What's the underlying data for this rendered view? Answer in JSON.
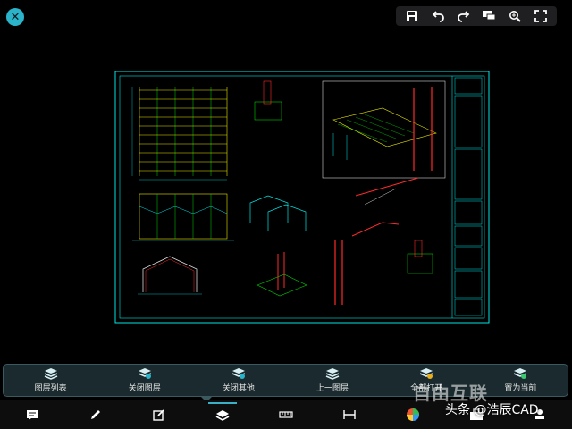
{
  "top_toolbar": {
    "icons": [
      "save-icon",
      "undo-icon",
      "redo-icon",
      "comment-icon",
      "zoom-icon",
      "fullscreen-icon"
    ]
  },
  "layer_panel": {
    "items": [
      {
        "label": "图层列表",
        "icon": "layers-list-icon"
      },
      {
        "label": "关闭图层",
        "icon": "layer-off-icon"
      },
      {
        "label": "关闭其他",
        "icon": "layer-off-others-icon"
      },
      {
        "label": "上一图层",
        "icon": "previous-layer-icon"
      },
      {
        "label": "全部打开",
        "icon": "open-all-layers-icon"
      },
      {
        "label": "置为当前",
        "icon": "set-current-layer-icon"
      }
    ]
  },
  "bottom_toolbar": {
    "icons": [
      "annotation-icon",
      "pencil-icon",
      "edit-icon",
      "layers-icon",
      "ruler-icon",
      "dimension-icon",
      "color-palette-icon",
      "toolbox-icon",
      "stamp-icon"
    ]
  },
  "watermark": {
    "text": "头条 @浩辰CAD",
    "logo_text": "自由互联"
  },
  "colors": {
    "accent": "#2bb3c9",
    "cad_cyan": "#00e5e5",
    "cad_yellow": "#e6e600",
    "cad_red": "#ff2a2a",
    "cad_green": "#00d000",
    "cad_white": "#d8d8d8"
  }
}
